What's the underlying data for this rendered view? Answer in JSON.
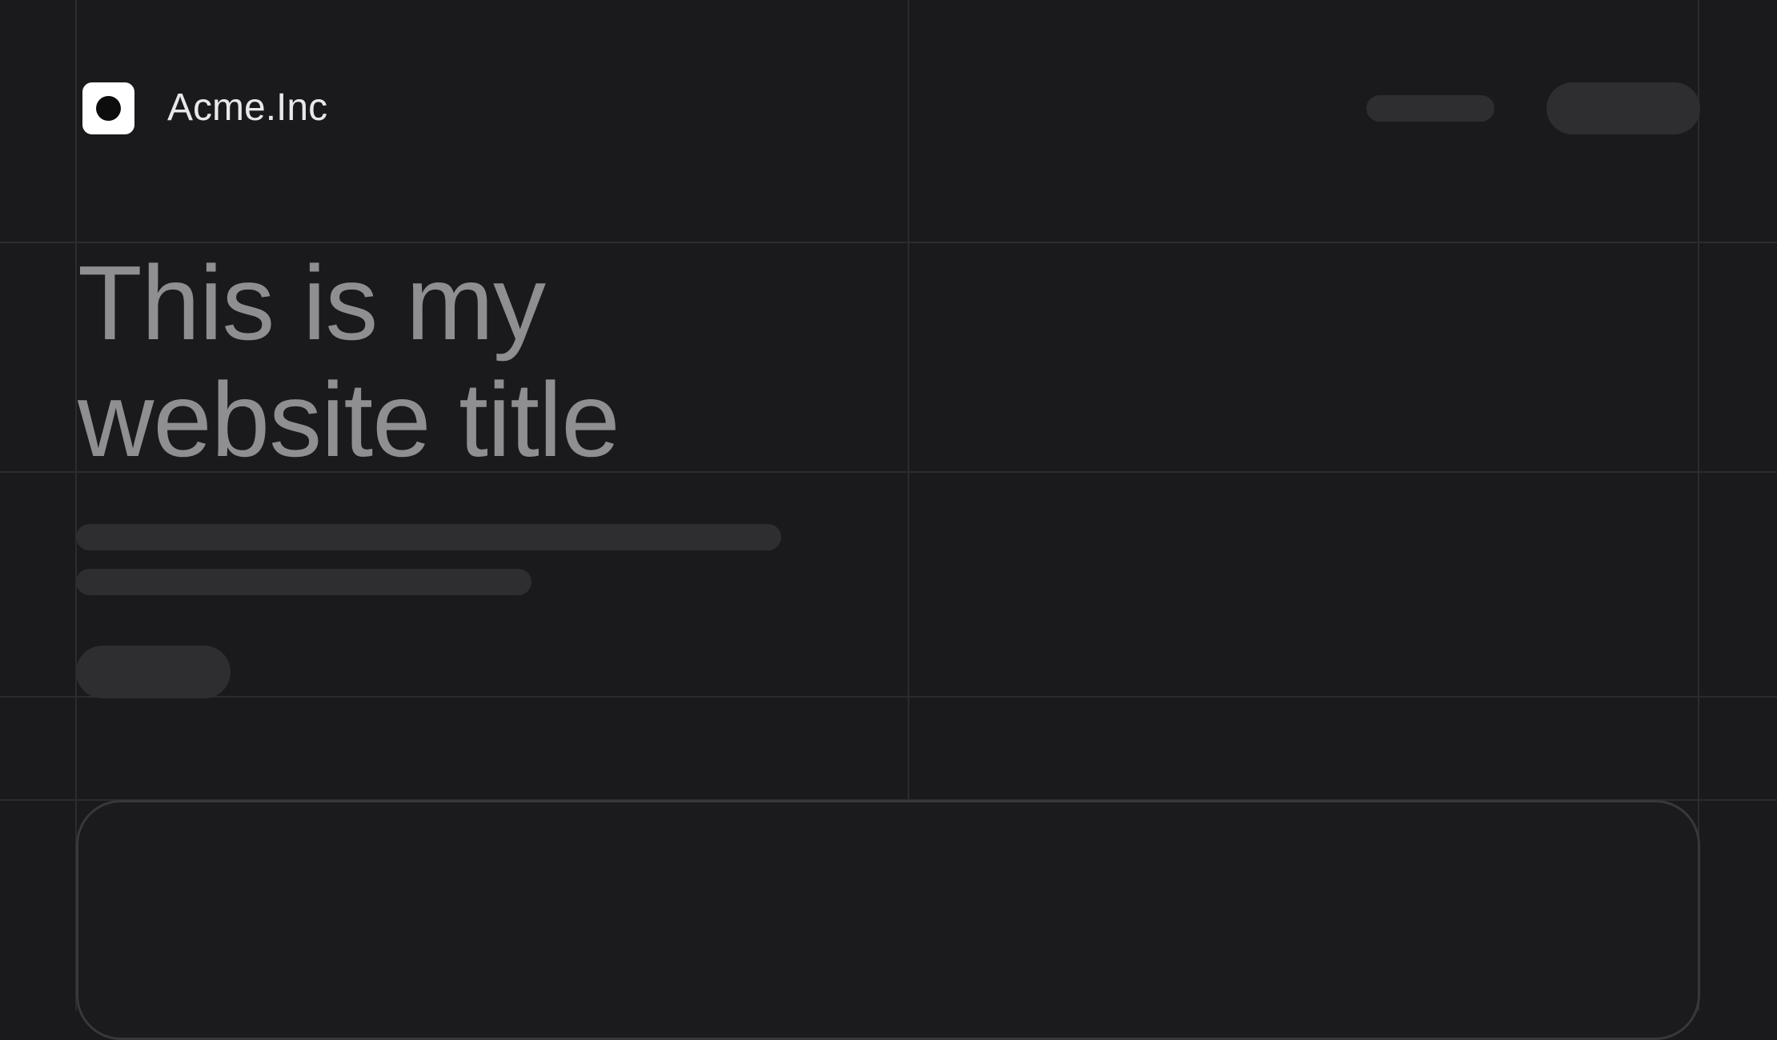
{
  "header": {
    "brand": "Acme.Inc"
  },
  "hero": {
    "title_line_1": "This is my",
    "title_line_2": "website title"
  }
}
